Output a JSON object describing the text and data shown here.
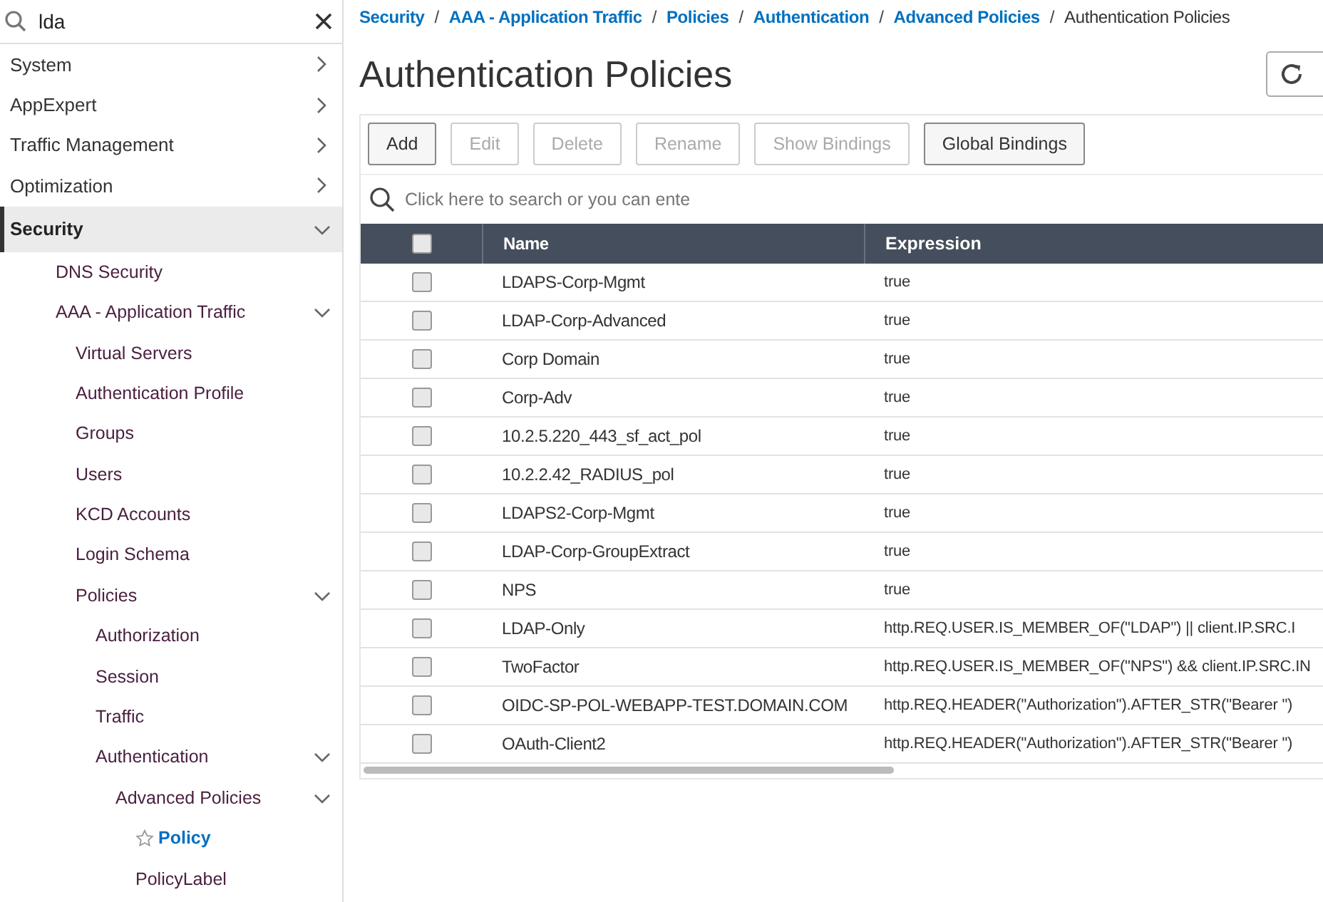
{
  "sidebar": {
    "search": {
      "value": "lda"
    },
    "items": [
      {
        "label": "System",
        "expanded": false,
        "active": false
      },
      {
        "label": "AppExpert",
        "expanded": false,
        "active": false
      },
      {
        "label": "Traffic Management",
        "expanded": false,
        "active": false
      },
      {
        "label": "Optimization",
        "expanded": false,
        "active": false
      },
      {
        "label": "Security",
        "expanded": true,
        "active": true,
        "children": [
          {
            "label": "DNS Security"
          },
          {
            "label": "AAA - Application Traffic",
            "expanded": true,
            "children": [
              {
                "label": "Virtual Servers"
              },
              {
                "label": "Authentication Profile"
              },
              {
                "label": "Groups"
              },
              {
                "label": "Users"
              },
              {
                "label": "KCD Accounts"
              },
              {
                "label": "Login Schema"
              },
              {
                "label": "Policies",
                "expanded": true,
                "children": [
                  {
                    "label": "Authorization"
                  },
                  {
                    "label": "Session"
                  },
                  {
                    "label": "Traffic"
                  },
                  {
                    "label": "Authentication",
                    "expanded": true,
                    "children": [
                      {
                        "label": "Advanced Policies",
                        "expanded": true,
                        "children": [
                          {
                            "label": "Policy",
                            "selected": true,
                            "favorite": false
                          },
                          {
                            "label": "PolicyLabel",
                            "selected": false
                          }
                        ]
                      }
                    ]
                  }
                ]
              }
            ]
          }
        ]
      }
    ]
  },
  "breadcrumb_separator": "/",
  "breadcrumb": [
    "Security",
    "AAA - Application Traffic",
    "Policies",
    "Authentication",
    "Advanced Policies",
    "Authentication Policies"
  ],
  "title": "Authentication Policies",
  "toolbar": [
    {
      "label": "Add",
      "disabled": false
    },
    {
      "label": "Edit",
      "disabled": true
    },
    {
      "label": "Delete",
      "disabled": true
    },
    {
      "label": "Rename",
      "disabled": true
    },
    {
      "label": "Show Bindings",
      "disabled": true
    },
    {
      "label": "Global Bindings",
      "disabled": false
    }
  ],
  "table_search": {
    "placeholder": "Click here to search or you can ente"
  },
  "table": {
    "select_all": false,
    "columns": [
      "Name",
      "Expression"
    ],
    "rows": [
      {
        "checked": false,
        "cells": [
          "LDAPS-Corp-Mgmt",
          "true"
        ]
      },
      {
        "checked": false,
        "cells": [
          "LDAP-Corp-Advanced",
          "true"
        ]
      },
      {
        "checked": false,
        "cells": [
          "Corp Domain",
          "true"
        ]
      },
      {
        "checked": false,
        "cells": [
          "Corp-Adv",
          "true"
        ]
      },
      {
        "checked": false,
        "cells": [
          "10.2.5.220_443_sf_act_pol",
          "true"
        ]
      },
      {
        "checked": false,
        "cells": [
          "10.2.2.42_RADIUS_pol",
          "true"
        ]
      },
      {
        "checked": false,
        "cells": [
          "LDAPS2-Corp-Mgmt",
          "true"
        ]
      },
      {
        "checked": false,
        "cells": [
          "LDAP-Corp-GroupExtract",
          "true"
        ]
      },
      {
        "checked": false,
        "cells": [
          "NPS",
          "true"
        ]
      },
      {
        "checked": false,
        "cells": [
          "LDAP-Only",
          "http.REQ.USER.IS_MEMBER_OF(\"LDAP\") || client.IP.SRC.I"
        ]
      },
      {
        "checked": false,
        "cells": [
          "TwoFactor",
          "http.REQ.USER.IS_MEMBER_OF(\"NPS\") && client.IP.SRC.IN"
        ]
      },
      {
        "checked": false,
        "cells": [
          "OIDC-SP-POL-WEBAPP-TEST.DOMAIN.COM",
          "http.REQ.HEADER(\"Authorization\").AFTER_STR(\"Bearer \")"
        ]
      },
      {
        "checked": false,
        "cells": [
          "OAuth-Client2",
          "http.REQ.HEADER(\"Authorization\").AFTER_STR(\"Bearer \")"
        ]
      }
    ]
  }
}
